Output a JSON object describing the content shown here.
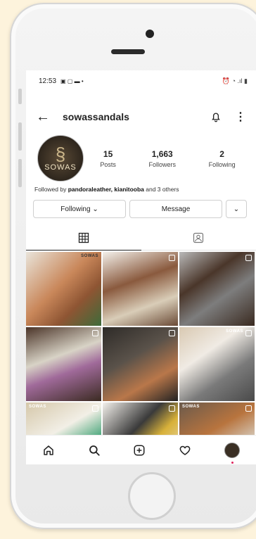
{
  "status": {
    "time": "12:53",
    "left_icons": "▣ ▢ ▬ •",
    "right_icons": "⏰ ◔ .ıl ▮"
  },
  "profile": {
    "username": "sowassandals",
    "avatar_text": "SOWAS",
    "stats": [
      {
        "value": "15",
        "label": "Posts"
      },
      {
        "value": "1,663",
        "label": "Followers"
      },
      {
        "value": "2",
        "label": "Following"
      }
    ],
    "followed_prefix": "Followed by ",
    "followed_names": "pandoraleather, kianitooba",
    "followed_suffix": " and 3 others"
  },
  "buttons": {
    "following": "Following ⌄",
    "message": "Message",
    "more": "⌄"
  },
  "tabs": [
    {
      "icon": "grid-icon",
      "active": true
    },
    {
      "icon": "tagged-icon",
      "active": false
    }
  ],
  "posts": [
    {
      "tag": "SOWAS",
      "multi": false
    },
    {
      "tag": "",
      "multi": true
    },
    {
      "tag": "",
      "multi": true
    },
    {
      "tag": "",
      "multi": true
    },
    {
      "tag": "",
      "multi": true
    },
    {
      "tag": "SOWAS",
      "multi": true
    },
    {
      "tag": "SOWAS",
      "multi": true
    },
    {
      "tag": "",
      "multi": true
    },
    {
      "tag": "SOWAS",
      "multi": true
    }
  ],
  "bottom_nav": [
    "home-icon",
    "search-icon",
    "add-post-icon",
    "heart-icon",
    "profile-avatar"
  ],
  "colors": {
    "accent": "#e0245e",
    "brand_dark": "#2e261d"
  }
}
